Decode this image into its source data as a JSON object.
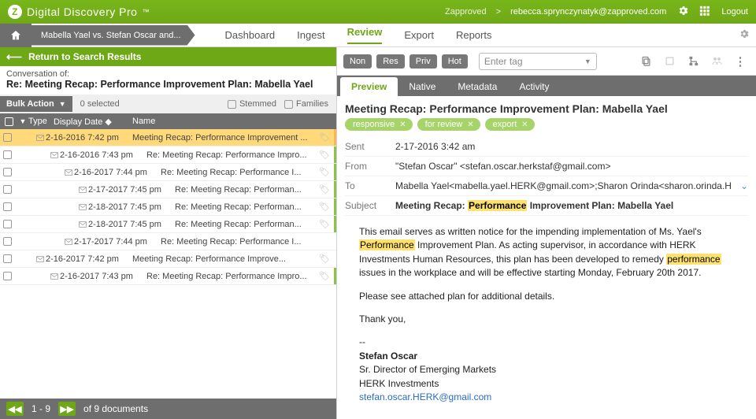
{
  "header": {
    "brand": "Digital Discovery Pro",
    "tm": "™",
    "org": "Zapproved",
    "sep": ">",
    "user": "rebecca.sprynczynatyk@zapproved.com",
    "logout": "Logout"
  },
  "nav": {
    "case": "Mabella Yael vs. Stefan Oscar and...",
    "items": [
      "Dashboard",
      "Ingest",
      "Review",
      "Export",
      "Reports"
    ],
    "active": 2
  },
  "left": {
    "return": "Return to Search Results",
    "conv_label": "Conversation of:",
    "conv_subject": "Re: Meeting Recap: Performance Improvement Plan: Mabella Yael",
    "bulk": "Bulk Action",
    "selected": "0 selected",
    "stemmed": "Stemmed",
    "families": "Families",
    "cols": {
      "type": "Type",
      "date": "Display Date",
      "name": "Name"
    },
    "rows": [
      {
        "indent": 0,
        "date": "2-16-2016 7:42 pm",
        "name": "Meeting Recap: Performance Improvement ...",
        "tag": true,
        "mark": "#ffb74d",
        "selected": true
      },
      {
        "indent": 1,
        "date": "2-16-2016 7:43 pm",
        "name": "Re: Meeting Recap: Performance Impro...",
        "tag": true,
        "mark": "#8bc34a"
      },
      {
        "indent": 2,
        "date": "2-16-2017 7:44 pm",
        "name": "Re: Meeting Recap: Performance I...",
        "tag": true,
        "mark": "#8bc34a"
      },
      {
        "indent": 3,
        "date": "2-17-2017 7:45 pm",
        "name": "Re: Meeting Recap: Performan...",
        "tag": true,
        "mark": "#8bc34a"
      },
      {
        "indent": 3,
        "date": "2-18-2017 7:45 pm",
        "name": "Re: Meeting Recap: Performan...",
        "tag": true,
        "mark": "#8bc34a"
      },
      {
        "indent": 3,
        "date": "2-18-2017 7:45 pm",
        "name": "Re: Meeting Recap: Performan...",
        "tag": true,
        "mark": "#8bc34a"
      },
      {
        "indent": 2,
        "date": "2-17-2017 7:44 pm",
        "name": "Re: Meeting Recap: Performance I...",
        "tag": false,
        "mark": ""
      },
      {
        "indent": 0,
        "date": "2-16-2017 7:42 pm",
        "name": "Meeting Recap: Performance Improve...",
        "tag": true,
        "mark": ""
      },
      {
        "indent": 1,
        "date": "2-16-2017 7:43 pm",
        "name": "Re: Meeting Recap: Performance Impro...",
        "tag": true,
        "mark": "#8bc34a"
      }
    ]
  },
  "right": {
    "pills": [
      "Non",
      "Res",
      "Priv",
      "Hot"
    ],
    "tag_placeholder": "Enter tag",
    "tabs": [
      "Preview",
      "Native",
      "Metadata",
      "Activity"
    ],
    "active_tab": 0,
    "title": "Meeting Recap: Performance Improvement Plan: Mabella Yael",
    "tags": [
      "responsive",
      "for review",
      "export"
    ],
    "meta": {
      "sent_k": "Sent",
      "sent_v": "2-17-2016 3:42 am",
      "from_k": "From",
      "from_v": "\"Stefan Oscar\" <stefan.oscar.herkstaf@gmail.com>",
      "to_k": "To",
      "to_v": "Mabella Yael<mabella.yael.HERK@gmail.com>;Sharon Orinda<sharon.orinda.H",
      "subject_k": "Subject",
      "subject_pre": "Meeting Recap: ",
      "subject_hl": "Performance",
      "subject_post": " Improvement Plan: Mabella Yael"
    },
    "body": {
      "p1a": "This email serves as written notice for the impending implementation of Ms. Yael's ",
      "p1h1": "Performance",
      "p1b": " Improvement Plan. As acting supervisor, in accordance with HERK Investments Human Resources, this plan has been developed to remedy ",
      "p1h2": "performance",
      "p1c": " issues in the workplace and will be effective starting Monday, February 20th 2017.",
      "p2": "Please see attached plan for additional details.",
      "p3": "Thank you,",
      "dash": "--",
      "sig1": "Stefan Oscar",
      "sig2": "Sr. Director of Emerging Markets",
      "sig3": "HERK Investments",
      "sig4": "stefan.oscar.HERK@gmail.com"
    }
  },
  "footer": {
    "range": "1 - 9",
    "of": "of  9 documents"
  }
}
